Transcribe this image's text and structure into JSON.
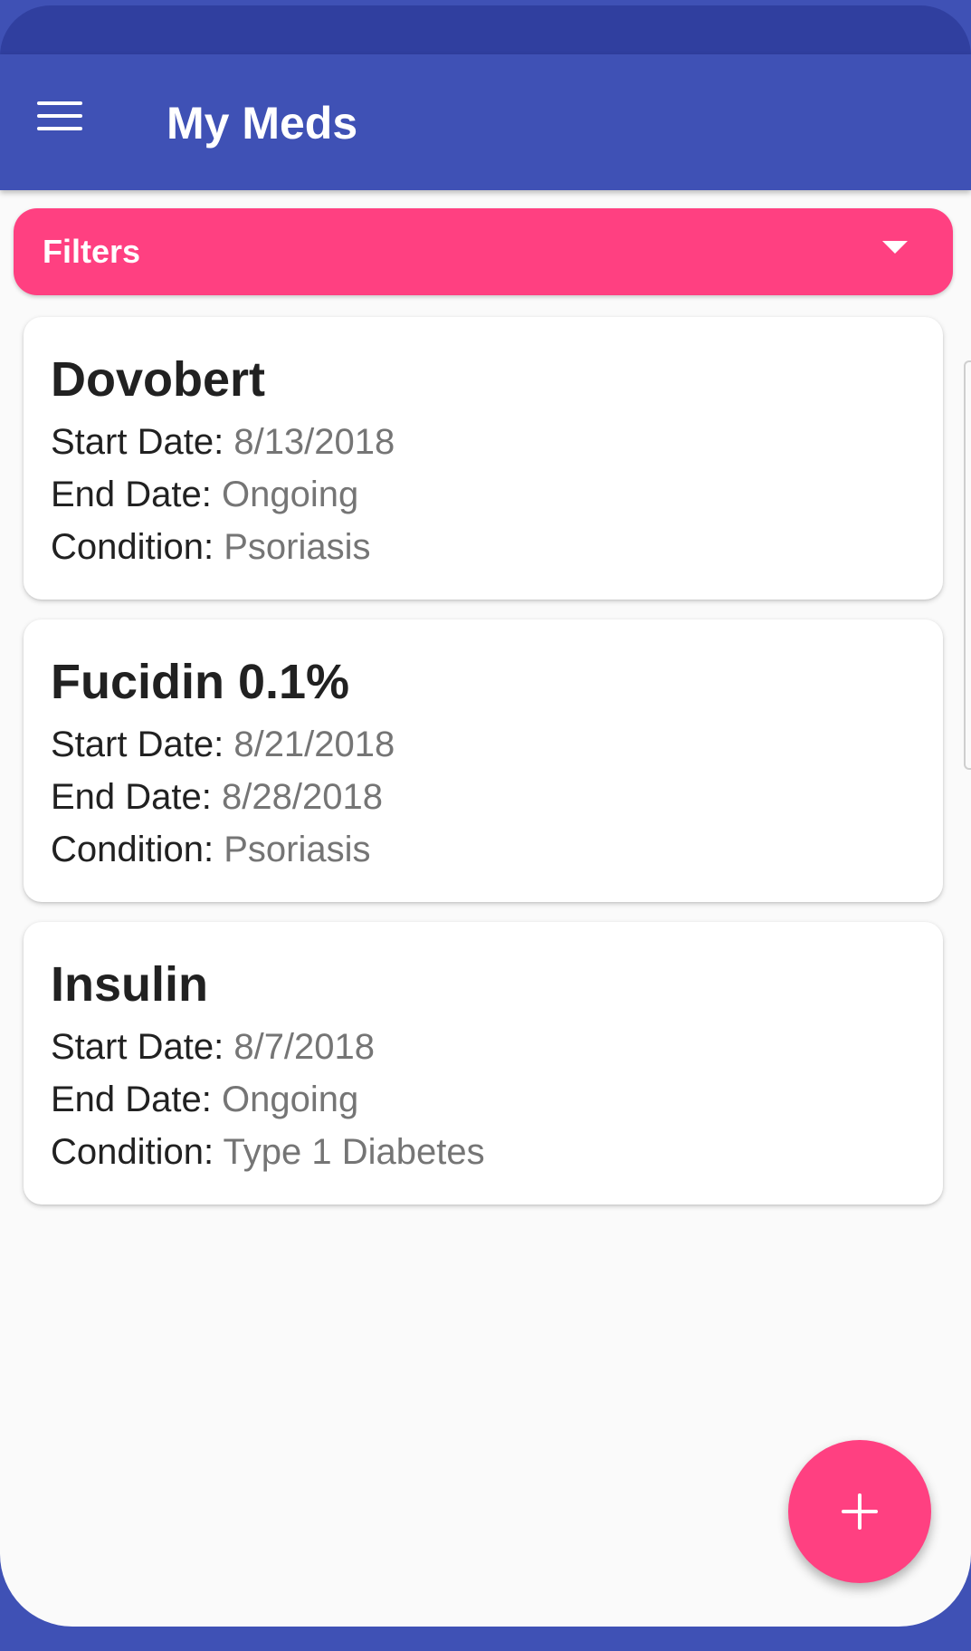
{
  "app_bar": {
    "title": "My Meds",
    "menu_icon": "menu-icon"
  },
  "filters": {
    "label": "Filters",
    "icon": "caret-down-icon"
  },
  "labels": {
    "start_date": "Start Date:",
    "end_date": "End Date:",
    "condition": "Condition:"
  },
  "medications": [
    {
      "name": "Dovobert",
      "start_date": "8/13/2018",
      "end_date": "Ongoing",
      "condition": "Psoriasis"
    },
    {
      "name": "Fucidin 0.1%",
      "start_date": "8/21/2018",
      "end_date": "8/28/2018",
      "condition": "Psoriasis"
    },
    {
      "name": "Insulin",
      "start_date": "8/7/2018",
      "end_date": "Ongoing",
      "condition": "Type 1 Diabetes"
    }
  ],
  "fab": {
    "icon": "plus-icon"
  },
  "colors": {
    "primary": "#3f51b5",
    "primary_dark": "#303f9f",
    "accent": "#ff4081",
    "background": "#fafafa",
    "text_primary": "#212121",
    "text_secondary": "#757575"
  }
}
